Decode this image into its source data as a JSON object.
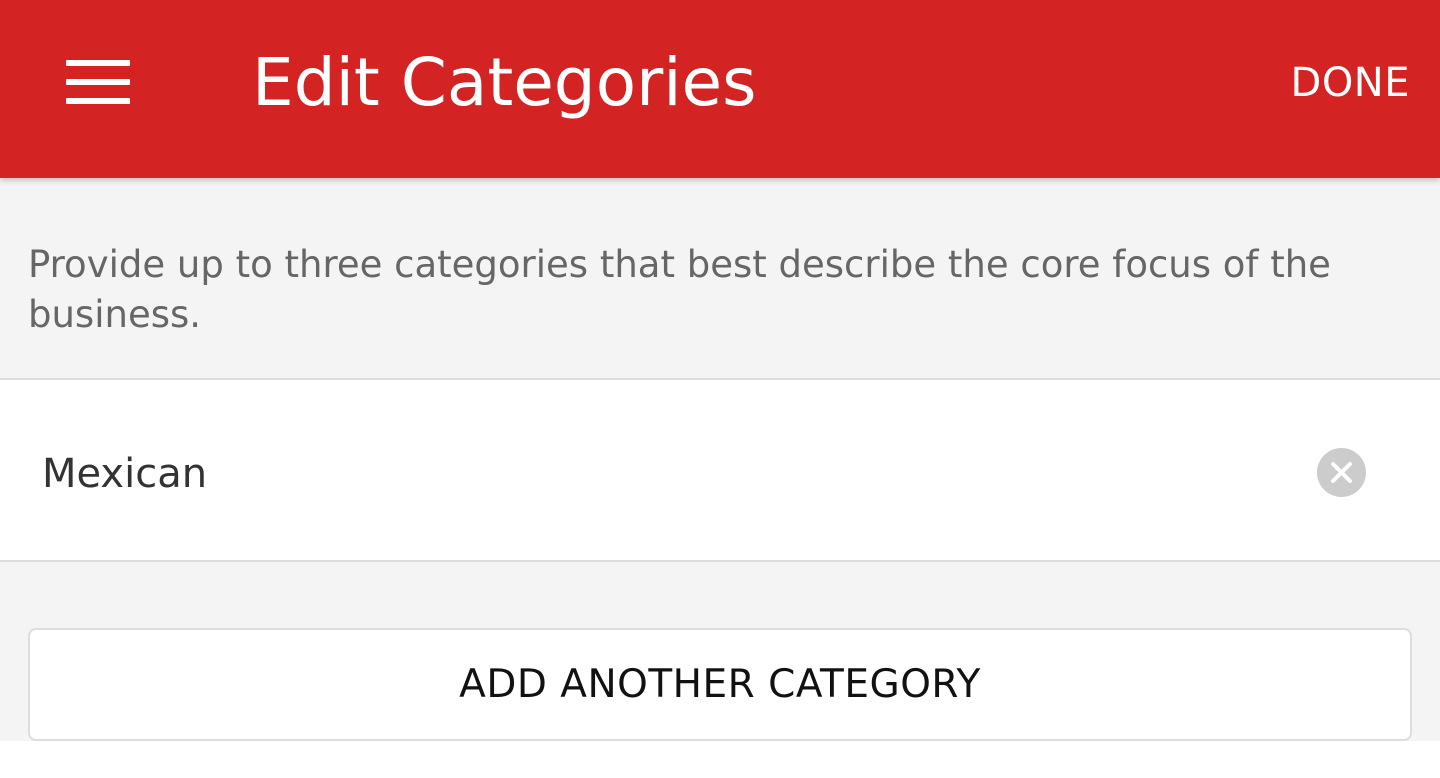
{
  "app_bar": {
    "menu_icon": "hamburger-menu-icon",
    "title": "Edit Categories",
    "done_label": "DONE",
    "color": "#d32323"
  },
  "description": "Provide up to three categories that best describe the core focus of the business.",
  "categories": [
    {
      "label": "Mexican",
      "clear_icon": "clear-circle-icon"
    }
  ],
  "add_button_label": "ADD ANOTHER CATEGORY"
}
